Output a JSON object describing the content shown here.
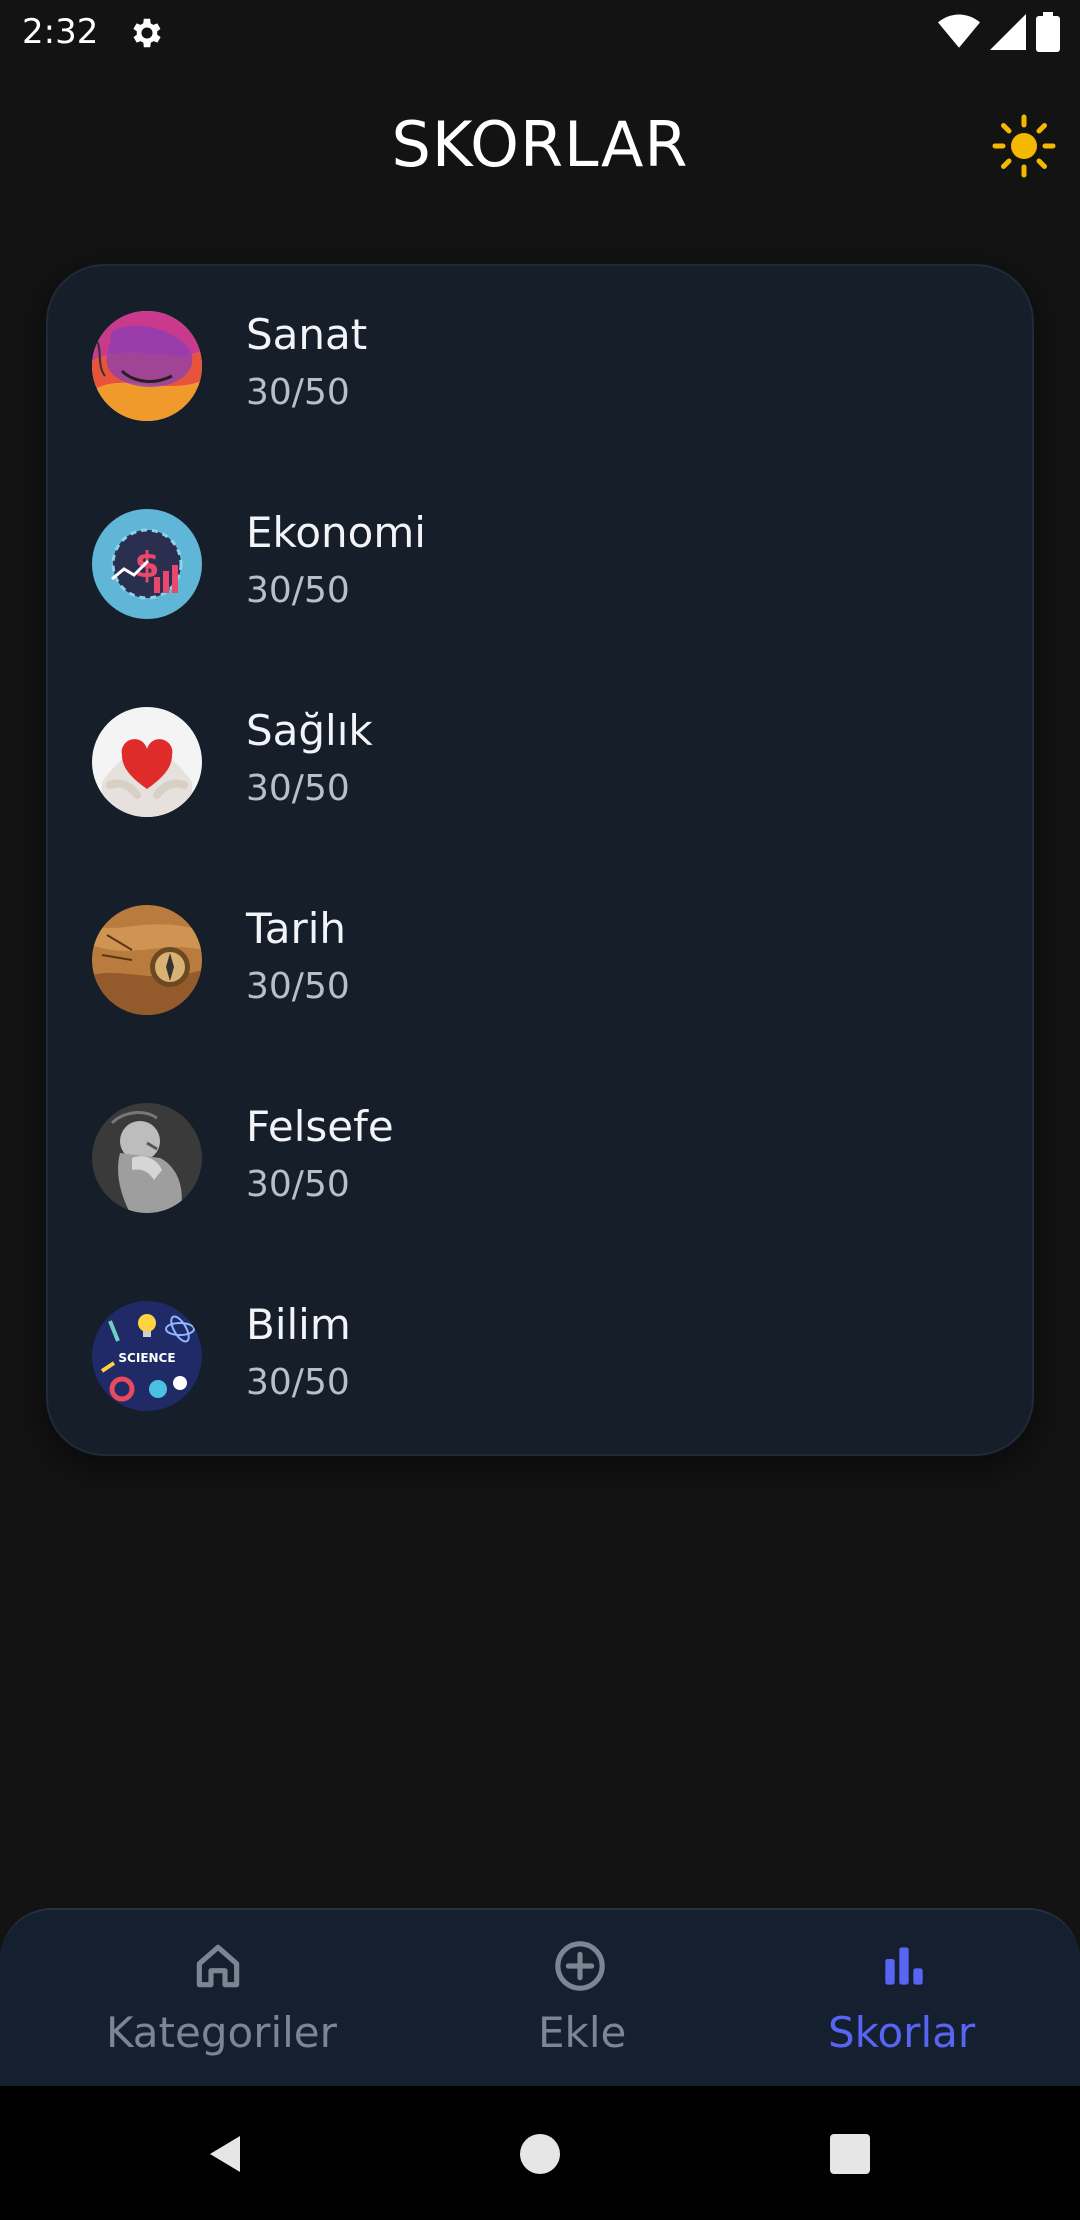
{
  "status_bar": {
    "time": "2:32",
    "icons": [
      "gear-icon",
      "wifi-icon",
      "signal-icon",
      "battery-icon"
    ]
  },
  "header": {
    "title": "SKORLAR",
    "theme_icon": "sun-icon",
    "theme_icon_color": "#f5b800"
  },
  "scores": {
    "items": [
      {
        "name": "Sanat",
        "score": "30/50",
        "icon": "art-avatar"
      },
      {
        "name": "Ekonomi",
        "score": "30/50",
        "icon": "economy-avatar"
      },
      {
        "name": "Sağlık",
        "score": "30/50",
        "icon": "health-avatar"
      },
      {
        "name": "Tarih",
        "score": "30/50",
        "icon": "history-avatar"
      },
      {
        "name": "Felsefe",
        "score": "30/50",
        "icon": "philosophy-avatar"
      },
      {
        "name": "Bilim",
        "score": "30/50",
        "icon": "science-avatar",
        "avatar_text": "SCIENCE"
      }
    ]
  },
  "bottom_nav": {
    "items": [
      {
        "label": "Kategoriler",
        "icon": "home-icon",
        "active": false
      },
      {
        "label": "Ekle",
        "icon": "add-circle-icon",
        "active": false
      },
      {
        "label": "Skorlar",
        "icon": "bar-chart-icon",
        "active": true
      }
    ],
    "active_color": "#5865f2",
    "inactive_color": "#7c8591"
  },
  "system_nav": {
    "icons": [
      "back-icon",
      "home-circle-icon",
      "recents-icon"
    ]
  }
}
